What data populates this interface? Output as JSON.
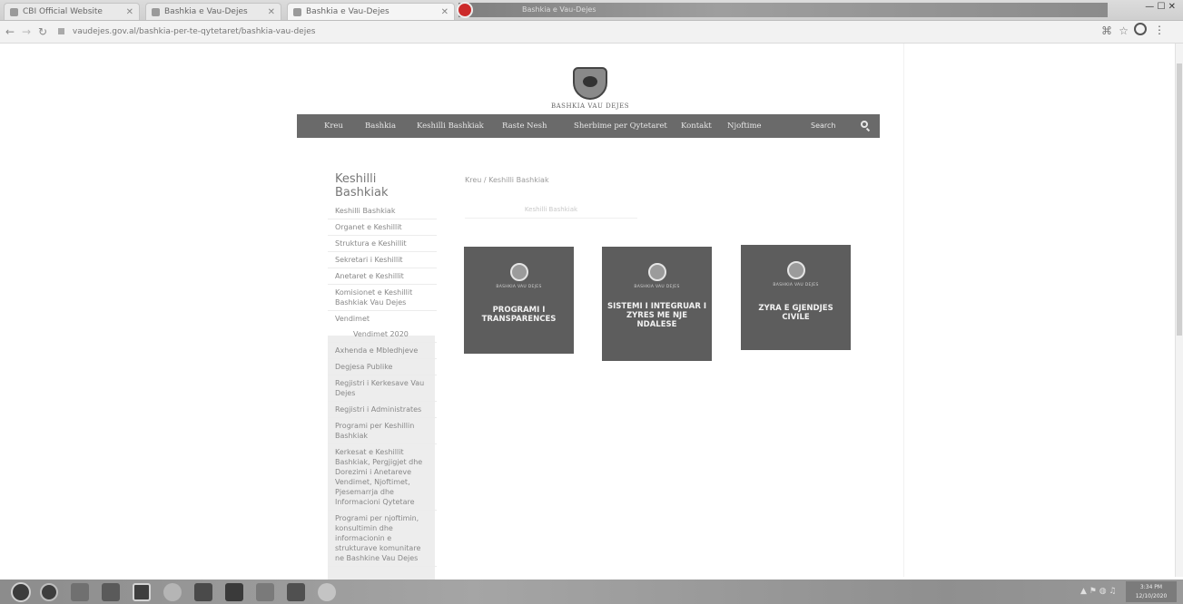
{
  "browser": {
    "tabs": [
      {
        "label": "CBI Official Website"
      },
      {
        "label": "Bashkia e Vau-Dejes"
      },
      {
        "label": "Bashkia e Vau-Dejes"
      }
    ],
    "ribbon_text": "Bashkia e Vau-Dejes",
    "url": "vaudejes.gov.al/bashkia-per-te-qytetaret/bashkia-vau-dejes"
  },
  "site": {
    "logo_text": "BASHKIA VAU DEJES",
    "nav": [
      "Kreu",
      "Bashkia",
      "Keshilli Bashkiak",
      "Raste Nesh",
      "Sherbime per Qytetaret",
      "Kontakt",
      "Njoftime"
    ],
    "search_label": "Search"
  },
  "sidebar": {
    "title": "Keshilli Bashkiak",
    "items": [
      {
        "label": "Keshilli Bashkiak"
      },
      {
        "label": "Organet e Keshillit"
      },
      {
        "label": "Struktura e Keshillit"
      },
      {
        "label": "Sekretari i Keshillit"
      },
      {
        "label": "Anetaret e Keshillit"
      },
      {
        "label": "Komisionet e Keshillit Bashkiak Vau Dejes"
      },
      {
        "label": "Vendimet"
      },
      {
        "label": "Vendimet 2020"
      },
      {
        "label": "Axhenda e Mbledhjeve"
      },
      {
        "label": "Degjesa Publike"
      },
      {
        "label": "Regjistri i Kerkesave Vau Dejes"
      },
      {
        "label": "Regjistri i Administrates"
      },
      {
        "label": "Programi per Keshillin Bashkiak"
      },
      {
        "label": "Kerkesat e Keshillit Bashkiak, Pergjigjet dhe Dorezimi i Anetareve Vendimet, Njoftimet, Pjesemarrja dhe Informacioni Qytetare"
      },
      {
        "label": "Programi per njoftimin, konsultimin dhe informacionin e strukturave komunitare ne Bashkine Vau Dejes"
      }
    ]
  },
  "content": {
    "breadcrumb": "Kreu / Keshilli Bashkiak",
    "heading": "Keshilli Bashkiak",
    "cards": [
      {
        "small": "BASHKIA VAU DEJES",
        "title": "PROGRAMI I TRANSPARENCES"
      },
      {
        "small": "BASHKIA VAU DEJES",
        "title": "SISTEMI I INTEGRUAR I ZYRES ME NJE NDALESE"
      },
      {
        "small": "BASHKIA VAU DEJES",
        "title": "ZYRA E GJENDJES CIVILE"
      }
    ]
  },
  "taskbar": {
    "clock_time": "3:34 PM",
    "clock_date": "12/10/2020"
  }
}
